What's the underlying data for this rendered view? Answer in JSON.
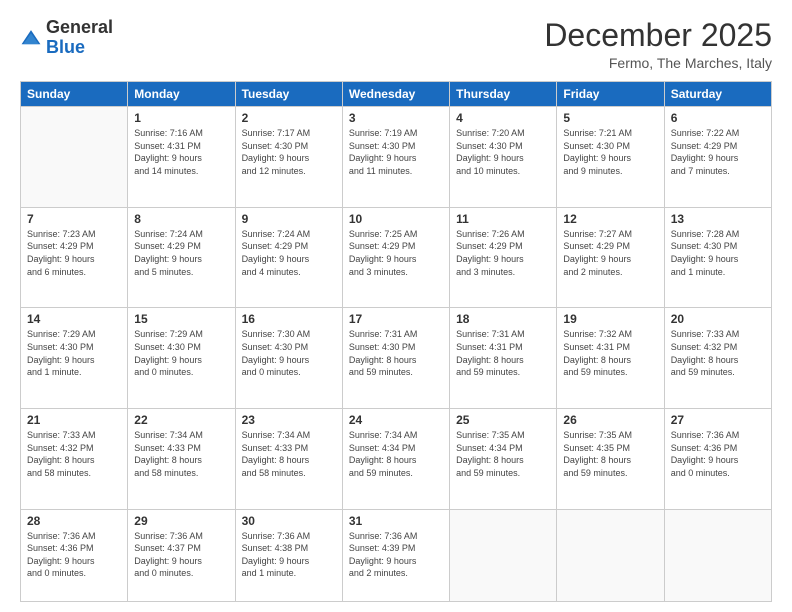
{
  "logo": {
    "general": "General",
    "blue": "Blue"
  },
  "header": {
    "month": "December 2025",
    "location": "Fermo, The Marches, Italy"
  },
  "weekdays": [
    "Sunday",
    "Monday",
    "Tuesday",
    "Wednesday",
    "Thursday",
    "Friday",
    "Saturday"
  ],
  "weeks": [
    [
      {
        "day": "",
        "info": ""
      },
      {
        "day": "1",
        "info": "Sunrise: 7:16 AM\nSunset: 4:31 PM\nDaylight: 9 hours\nand 14 minutes."
      },
      {
        "day": "2",
        "info": "Sunrise: 7:17 AM\nSunset: 4:30 PM\nDaylight: 9 hours\nand 12 minutes."
      },
      {
        "day": "3",
        "info": "Sunrise: 7:19 AM\nSunset: 4:30 PM\nDaylight: 9 hours\nand 11 minutes."
      },
      {
        "day": "4",
        "info": "Sunrise: 7:20 AM\nSunset: 4:30 PM\nDaylight: 9 hours\nand 10 minutes."
      },
      {
        "day": "5",
        "info": "Sunrise: 7:21 AM\nSunset: 4:30 PM\nDaylight: 9 hours\nand 9 minutes."
      },
      {
        "day": "6",
        "info": "Sunrise: 7:22 AM\nSunset: 4:29 PM\nDaylight: 9 hours\nand 7 minutes."
      }
    ],
    [
      {
        "day": "7",
        "info": "Sunrise: 7:23 AM\nSunset: 4:29 PM\nDaylight: 9 hours\nand 6 minutes."
      },
      {
        "day": "8",
        "info": "Sunrise: 7:24 AM\nSunset: 4:29 PM\nDaylight: 9 hours\nand 5 minutes."
      },
      {
        "day": "9",
        "info": "Sunrise: 7:24 AM\nSunset: 4:29 PM\nDaylight: 9 hours\nand 4 minutes."
      },
      {
        "day": "10",
        "info": "Sunrise: 7:25 AM\nSunset: 4:29 PM\nDaylight: 9 hours\nand 3 minutes."
      },
      {
        "day": "11",
        "info": "Sunrise: 7:26 AM\nSunset: 4:29 PM\nDaylight: 9 hours\nand 3 minutes."
      },
      {
        "day": "12",
        "info": "Sunrise: 7:27 AM\nSunset: 4:29 PM\nDaylight: 9 hours\nand 2 minutes."
      },
      {
        "day": "13",
        "info": "Sunrise: 7:28 AM\nSunset: 4:30 PM\nDaylight: 9 hours\nand 1 minute."
      }
    ],
    [
      {
        "day": "14",
        "info": "Sunrise: 7:29 AM\nSunset: 4:30 PM\nDaylight: 9 hours\nand 1 minute."
      },
      {
        "day": "15",
        "info": "Sunrise: 7:29 AM\nSunset: 4:30 PM\nDaylight: 9 hours\nand 0 minutes."
      },
      {
        "day": "16",
        "info": "Sunrise: 7:30 AM\nSunset: 4:30 PM\nDaylight: 9 hours\nand 0 minutes."
      },
      {
        "day": "17",
        "info": "Sunrise: 7:31 AM\nSunset: 4:30 PM\nDaylight: 8 hours\nand 59 minutes."
      },
      {
        "day": "18",
        "info": "Sunrise: 7:31 AM\nSunset: 4:31 PM\nDaylight: 8 hours\nand 59 minutes."
      },
      {
        "day": "19",
        "info": "Sunrise: 7:32 AM\nSunset: 4:31 PM\nDaylight: 8 hours\nand 59 minutes."
      },
      {
        "day": "20",
        "info": "Sunrise: 7:33 AM\nSunset: 4:32 PM\nDaylight: 8 hours\nand 59 minutes."
      }
    ],
    [
      {
        "day": "21",
        "info": "Sunrise: 7:33 AM\nSunset: 4:32 PM\nDaylight: 8 hours\nand 58 minutes."
      },
      {
        "day": "22",
        "info": "Sunrise: 7:34 AM\nSunset: 4:33 PM\nDaylight: 8 hours\nand 58 minutes."
      },
      {
        "day": "23",
        "info": "Sunrise: 7:34 AM\nSunset: 4:33 PM\nDaylight: 8 hours\nand 58 minutes."
      },
      {
        "day": "24",
        "info": "Sunrise: 7:34 AM\nSunset: 4:34 PM\nDaylight: 8 hours\nand 59 minutes."
      },
      {
        "day": "25",
        "info": "Sunrise: 7:35 AM\nSunset: 4:34 PM\nDaylight: 8 hours\nand 59 minutes."
      },
      {
        "day": "26",
        "info": "Sunrise: 7:35 AM\nSunset: 4:35 PM\nDaylight: 8 hours\nand 59 minutes."
      },
      {
        "day": "27",
        "info": "Sunrise: 7:36 AM\nSunset: 4:36 PM\nDaylight: 9 hours\nand 0 minutes."
      }
    ],
    [
      {
        "day": "28",
        "info": "Sunrise: 7:36 AM\nSunset: 4:36 PM\nDaylight: 9 hours\nand 0 minutes."
      },
      {
        "day": "29",
        "info": "Sunrise: 7:36 AM\nSunset: 4:37 PM\nDaylight: 9 hours\nand 0 minutes."
      },
      {
        "day": "30",
        "info": "Sunrise: 7:36 AM\nSunset: 4:38 PM\nDaylight: 9 hours\nand 1 minute."
      },
      {
        "day": "31",
        "info": "Sunrise: 7:36 AM\nSunset: 4:39 PM\nDaylight: 9 hours\nand 2 minutes."
      },
      {
        "day": "",
        "info": ""
      },
      {
        "day": "",
        "info": ""
      },
      {
        "day": "",
        "info": ""
      }
    ]
  ]
}
